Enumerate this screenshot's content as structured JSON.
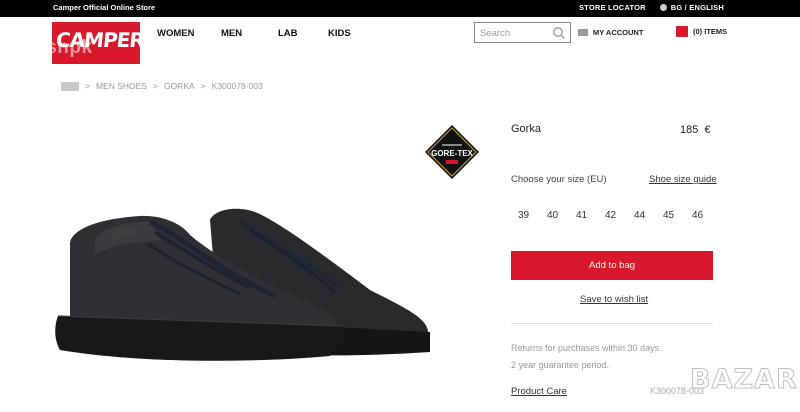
{
  "topbar": {
    "promo": "Camper Official Online Store",
    "store_locator": "STORE LOCATOR",
    "language": "BG / ENGLISH"
  },
  "header": {
    "logo_text": "CAMPER",
    "watermark": "pushpk",
    "nav": [
      "WOMEN",
      "MEN",
      "LAB",
      "KIDS"
    ],
    "search_placeholder": "Search",
    "account_label": "MY ACCOUNT",
    "bag_label": "(0) ITEMS"
  },
  "breadcrumb": [
    "MEN SHOES",
    "GORKA",
    "K300078-003"
  ],
  "breadcrumb_separator": ">",
  "product": {
    "name": "Gorka",
    "price": "185",
    "currency": "€",
    "size_label": "Choose your size (EU)",
    "size_guide": "Shoe size guide",
    "sizes": [
      "39",
      "40",
      "41",
      "42",
      "44",
      "45",
      "46"
    ],
    "add_to_bag": "Add to bag",
    "wishlist": "Save to wish list",
    "returns": "Returns for purchases within 30 days.",
    "guarantee": "2 year guarantee period.",
    "care": "Product Care",
    "code": "K300078-003",
    "badge_text": "GORE-TEX"
  },
  "bazar_watermark": "BAZAR",
  "colors": {
    "brand_red": "#d7192b",
    "topbar": "#000000"
  },
  "icons": [
    "home-icon",
    "search-icon",
    "account-icon",
    "bag-icon",
    "globe-icon"
  ]
}
